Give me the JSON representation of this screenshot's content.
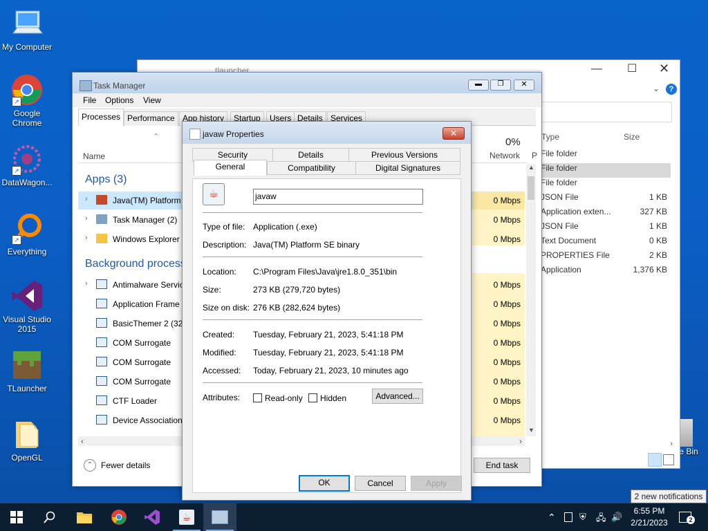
{
  "desktop": {
    "icons": [
      {
        "label": "My Computer"
      },
      {
        "label": "Google Chrome"
      },
      {
        "label": "DataWagon..."
      },
      {
        "label": "Everything"
      },
      {
        "label": "Visual Studio 2015"
      },
      {
        "label": "TLauncher"
      },
      {
        "label": "OpenGL"
      }
    ],
    "recycle_bin_label": "e Bin"
  },
  "explorer": {
    "title": "tlauncher",
    "col_type": "Type",
    "col_size": "Size",
    "rows": [
      {
        "type": "File folder",
        "size": ""
      },
      {
        "type": "File folder",
        "size": ""
      },
      {
        "type": "File folder",
        "size": ""
      },
      {
        "type": "JSON File",
        "size": "1 KB"
      },
      {
        "type": "Application exten...",
        "size": "327 KB"
      },
      {
        "type": "JSON File",
        "size": "1 KB"
      },
      {
        "type": "Text Document",
        "size": "0 KB"
      },
      {
        "type": "PROPERTIES File",
        "size": "2 KB"
      },
      {
        "type": "Application",
        "size": "1,376 KB"
      }
    ]
  },
  "taskmgr": {
    "title": "Task Manager",
    "menu": [
      "File",
      "Options",
      "View"
    ],
    "tabs": [
      "Processes",
      "Performance",
      "App history",
      "Startup",
      "Users",
      "Details",
      "Services"
    ],
    "col_name": "Name",
    "net_pct": "0%",
    "net_label": "Network",
    "p_label": "P",
    "apps_header": "Apps (3)",
    "apps": [
      {
        "name": "Java(TM) Platform",
        "net": "0 Mbps"
      },
      {
        "name": "Task Manager (2)",
        "net": "0 Mbps"
      },
      {
        "name": "Windows Explorer",
        "net": "0 Mbps"
      }
    ],
    "bg_header": "Background process",
    "bg": [
      {
        "name": "Antimalware Servic",
        "net": "0 Mbps"
      },
      {
        "name": "Application Frame",
        "net": "0 Mbps"
      },
      {
        "name": "BasicThemer 2 (32",
        "net": "0 Mbps"
      },
      {
        "name": "COM Surrogate",
        "net": "0 Mbps"
      },
      {
        "name": "COM Surrogate",
        "net": "0 Mbps"
      },
      {
        "name": "COM Surrogate",
        "net": "0 Mbps"
      },
      {
        "name": "CTF Loader",
        "net": "0 Mbps"
      },
      {
        "name": "Device Association",
        "net": "0 Mbps"
      }
    ],
    "fewer_details": "Fewer details",
    "end_task": "End task"
  },
  "props": {
    "title": "javaw Properties",
    "tabs_top": [
      "Security",
      "Details",
      "Previous Versions"
    ],
    "tabs_bottom": [
      "General",
      "Compatibility",
      "Digital Signatures"
    ],
    "filename": "javaw",
    "type_label": "Type of file:",
    "type_value": "Application (.exe)",
    "desc_label": "Description:",
    "desc_value": "Java(TM) Platform SE binary",
    "loc_label": "Location:",
    "loc_value": "C:\\Program Files\\Java\\jre1.8.0_351\\bin",
    "size_label": "Size:",
    "size_value": "273 KB (279,720 bytes)",
    "disk_label": "Size on disk:",
    "disk_value": "276 KB (282,624 bytes)",
    "created_label": "Created:",
    "created_value": "Tuesday, February 21, 2023, 5:41:18 PM",
    "modified_label": "Modified:",
    "modified_value": "Tuesday, February 21, 2023, 5:41:18 PM",
    "accessed_label": "Accessed:",
    "accessed_value": "Today, February 21, 2023, 10 minutes ago",
    "attr_label": "Attributes:",
    "readonly_label": "Read-only",
    "hidden_label": "Hidden",
    "advanced_label": "Advanced...",
    "ok_label": "OK",
    "cancel_label": "Cancel",
    "apply_label": "Apply"
  },
  "taskbar": {
    "time": "6:55 PM",
    "date": "2/21/2023",
    "notif_count": "2",
    "notif_tip": "2 new notifications"
  }
}
